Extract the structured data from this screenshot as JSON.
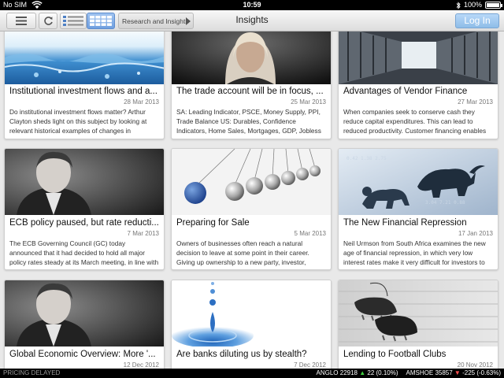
{
  "status": {
    "carrier": "No SIM",
    "time": "10:59",
    "battery_label": "100%",
    "battery_level": 1.0
  },
  "toolbar": {
    "section_label": "Research and Insights",
    "title": "Insights",
    "login_label": "Log In"
  },
  "cards": [
    {
      "title": "Institutional investment flows and a...",
      "date": "28 Mar 2013",
      "summary": "Do institutional investment flows matter? Arthur Clayton sheds light on this subject by looking at relevant historical examples of changes in",
      "image": "water-surface"
    },
    {
      "title": "The trade account will be in focus, ...",
      "date": "25 Mar 2013",
      "summary": "SA: Leading Indicator, PSCE, Money Supply, PPI, Trade Balance US: Durables, Confidence Indicators, Home Sales, Mortgages, GDP, Jobless Claims, PCE",
      "image": "woman-portrait"
    },
    {
      "title": "Advantages of Vendor Finance",
      "date": "27 Mar 2013",
      "summary": "When companies seek to conserve cash they reduce capital expenditures. This can lead to reduced productivity. Customer financing enables",
      "image": "server-room"
    },
    {
      "title": "ECB policy paused, but rate reducti...",
      "date": "7 Mar 2013",
      "summary": "The ECB Governing Council (GC) today announced that it had decided to hold all major policy rates steady at its March meeting, in line with the market",
      "image": "man-portrait"
    },
    {
      "title": "Preparing for Sale",
      "date": "5 Mar 2013",
      "summary": "Owners of businesses often reach a natural decision to leave at some point in their career. Giving up ownership to a new party, investor, private equity",
      "image": "newtons-cradle"
    },
    {
      "title": "The New Financial Repression",
      "date": "17 Jan 2013",
      "summary": "Neil Urmson from South Africa examines the new age of financial repression, in which very low interest rates make it very difficult for investors to",
      "image": "bull-and-bear"
    },
    {
      "title": "Global Economic Overview: More '...",
      "date": "12 Dec 2012",
      "summary": "",
      "image": "man-portrait"
    },
    {
      "title": "Are banks diluting us by stealth?",
      "date": "7 Dec 2012",
      "summary": "",
      "image": "water-drop"
    },
    {
      "title": "Lending to Football Clubs",
      "date": "20 Nov 2012",
      "summary": "",
      "image": "football-boots"
    }
  ],
  "ticker": {
    "delayed_label": "PRICING DELAYED",
    "items": [
      {
        "symbol": "ANGLO",
        "price": "22918",
        "change": "22 (0.10%)",
        "direction": "up"
      },
      {
        "symbol": "AMSHOE",
        "price": "35857",
        "change": "-225 (-0.63%)",
        "direction": "down"
      }
    ]
  },
  "colors": {
    "accent": "#6f9fe0",
    "login": "#8ebde8",
    "up": "#3ecf3e",
    "down": "#ff5050"
  }
}
